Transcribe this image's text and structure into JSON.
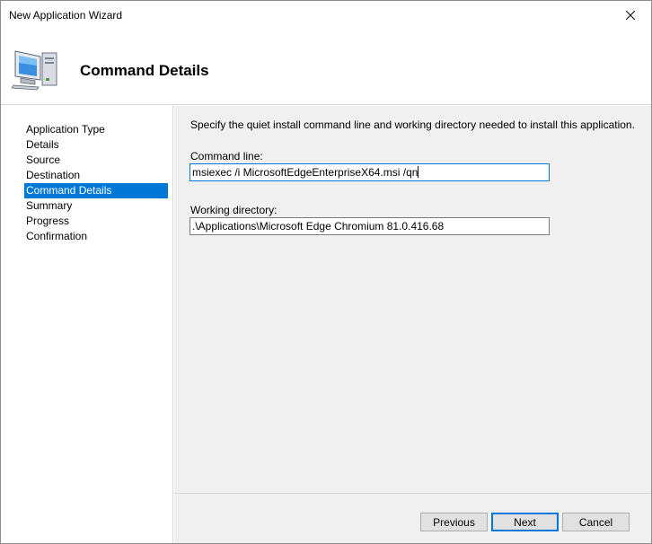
{
  "window": {
    "title": "New Application Wizard"
  },
  "header": {
    "title": "Command Details",
    "icon": "computer-icon"
  },
  "sidebar": {
    "items": [
      {
        "label": "Application Type"
      },
      {
        "label": "Details"
      },
      {
        "label": "Source"
      },
      {
        "label": "Destination"
      },
      {
        "label": "Command Details",
        "active": true
      },
      {
        "label": "Summary"
      },
      {
        "label": "Progress"
      },
      {
        "label": "Confirmation"
      }
    ]
  },
  "content": {
    "instruction": "Specify the quiet install command line and working directory needed to install this application.",
    "command_line": {
      "label": "Command line:",
      "value": "msiexec /i MicrosoftEdgeEnterpriseX64.msi /qn"
    },
    "working_directory": {
      "label": "Working directory:",
      "value": ".\\Applications\\Microsoft Edge Chromium 81.0.416.68"
    }
  },
  "buttons": {
    "previous": "Previous",
    "next": "Next",
    "cancel": "Cancel"
  },
  "colors": {
    "accent": "#0078d7",
    "panel_bg": "#f0f0f0",
    "button_bg": "#e1e1e1"
  }
}
